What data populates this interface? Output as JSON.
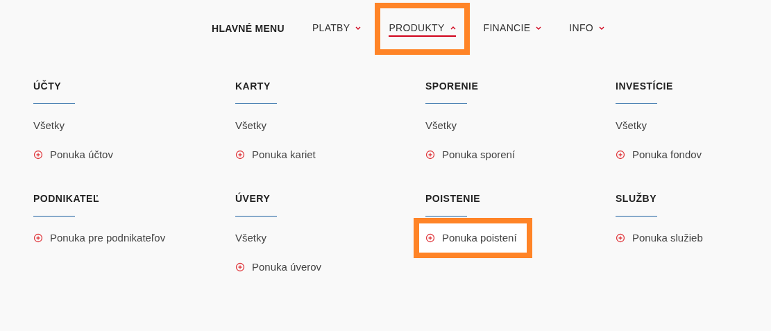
{
  "nav": {
    "title": "HLAVNÉ MENU",
    "items": [
      {
        "label": "PLATBY",
        "expanded": false,
        "selected": false,
        "highlighted": false
      },
      {
        "label": "PRODUKTY",
        "expanded": true,
        "selected": true,
        "highlighted": true
      },
      {
        "label": "FINANCIE",
        "expanded": false,
        "selected": false,
        "highlighted": false
      },
      {
        "label": "INFO",
        "expanded": false,
        "selected": false,
        "highlighted": false
      }
    ]
  },
  "sections": [
    {
      "title": "ÚČTY",
      "links": [
        {
          "kind": "all",
          "label": "Všetky",
          "highlighted": false
        },
        {
          "kind": "offer",
          "label": "Ponuka účtov",
          "highlighted": false
        }
      ]
    },
    {
      "title": "KARTY",
      "links": [
        {
          "kind": "all",
          "label": "Všetky",
          "highlighted": false
        },
        {
          "kind": "offer",
          "label": "Ponuka kariet",
          "highlighted": false
        }
      ]
    },
    {
      "title": "SPORENIE",
      "links": [
        {
          "kind": "all",
          "label": "Všetky",
          "highlighted": false
        },
        {
          "kind": "offer",
          "label": "Ponuka sporení",
          "highlighted": false
        }
      ]
    },
    {
      "title": "INVESTÍCIE",
      "links": [
        {
          "kind": "all",
          "label": "Všetky",
          "highlighted": false
        },
        {
          "kind": "offer",
          "label": "Ponuka fondov",
          "highlighted": false
        }
      ]
    },
    {
      "title": "PODNIKATEĽ",
      "links": [
        {
          "kind": "offer",
          "label": "Ponuka pre podnikateľov",
          "highlighted": false
        }
      ]
    },
    {
      "title": "ÚVERY",
      "links": [
        {
          "kind": "all",
          "label": "Všetky",
          "highlighted": false
        },
        {
          "kind": "offer",
          "label": "Ponuka úverov",
          "highlighted": false
        }
      ]
    },
    {
      "title": "POISTENIE",
      "links": [
        {
          "kind": "offer",
          "label": "Ponuka poistení",
          "highlighted": true
        }
      ]
    },
    {
      "title": "SLUŽBY",
      "links": [
        {
          "kind": "offer",
          "label": "Ponuka služieb",
          "highlighted": false
        }
      ]
    }
  ]
}
